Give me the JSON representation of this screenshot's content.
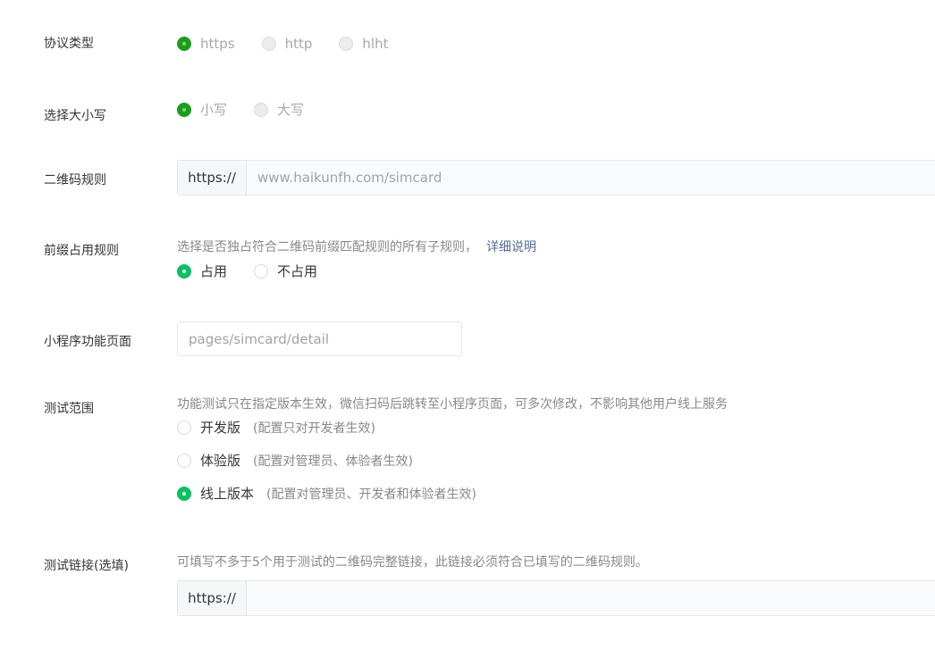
{
  "protocol": {
    "label": "协议类型",
    "options": [
      {
        "label": "https",
        "checked": true
      },
      {
        "label": "http",
        "checked": false
      },
      {
        "label": "hlht",
        "checked": false
      }
    ]
  },
  "case": {
    "label": "选择大小写",
    "options": [
      {
        "label": "小写",
        "checked": true
      },
      {
        "label": "大写",
        "checked": false
      }
    ]
  },
  "qr_rule": {
    "label": "二维码规则",
    "prefix": "https://",
    "placeholder": "www.haikunfh.com/simcard"
  },
  "prefix_rule": {
    "label": "前缀占用规则",
    "hint": "选择是否独占符合二维码前缀匹配规则的所有子规则，",
    "link": "详细说明",
    "options": [
      {
        "label": "占用",
        "checked": true
      },
      {
        "label": "不占用",
        "checked": false
      }
    ]
  },
  "mini_page": {
    "label": "小程序功能页面",
    "placeholder": "pages/simcard/detail"
  },
  "test_scope": {
    "label": "测试范围",
    "hint": "功能测试只在指定版本生效，微信扫码后跳转至小程序页面，可多次修改，不影响其他用户线上服务",
    "options": [
      {
        "label": "开发版",
        "note": "(配置只对开发者生效)",
        "checked": false
      },
      {
        "label": "体验版",
        "note": "(配置对管理员、体验者生效)",
        "checked": false
      },
      {
        "label": "线上版本",
        "note": "(配置对管理员、开发者和体验者生效)",
        "checked": true
      }
    ]
  },
  "test_link": {
    "label": "测试链接(选填)",
    "hint": "可填写不多于5个用于测试的二维码完整链接，此链接必须符合已填写的二维码规则。",
    "prefix": "https://",
    "value": ""
  },
  "colors": {
    "accent": "#07c160",
    "disabled_accent": "#1aad19",
    "link": "#576b95"
  }
}
